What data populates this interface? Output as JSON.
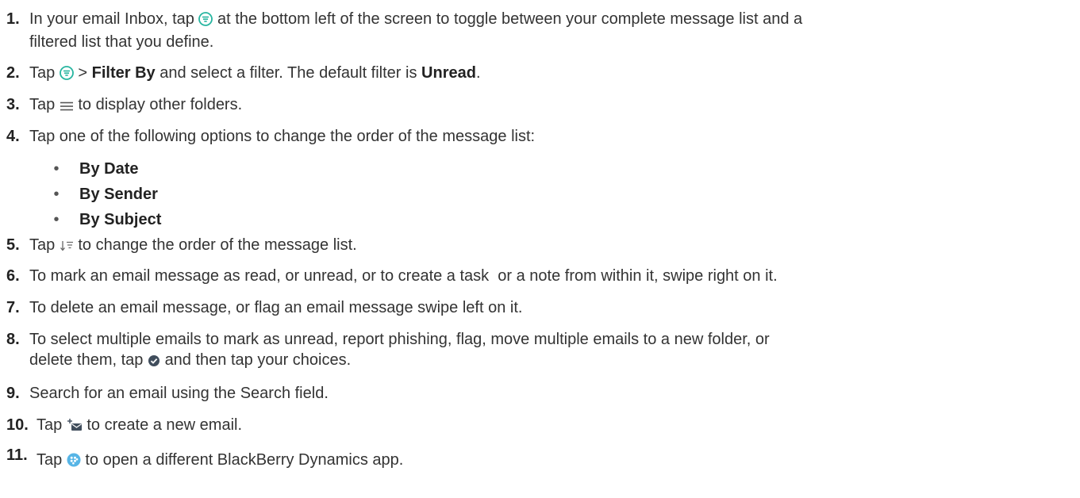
{
  "colors": {
    "text": "#333333",
    "heading": "#222222",
    "filter_icon": "#27b5a0",
    "checkmark_icon": "#404d5c",
    "dynamics_icon": "#57b5e6",
    "compose_icon": "#404d5c",
    "bullet": "#555555"
  },
  "steps": [
    {
      "number": "1.",
      "t1": "In your email Inbox, tap",
      "icon": "filter-icon",
      "t2": "at the bottom left of the screen to toggle between your complete message list and a",
      "line2": "filtered list that you define."
    },
    {
      "number": "2.",
      "t1": "Tap",
      "icon": "filter-icon",
      "t2": ">",
      "b1": "Filter By",
      "t3": "and select a filter. The default filter is",
      "b2": "Unread",
      "t4": "."
    },
    {
      "number": "3.",
      "t1": "Tap",
      "icon": "hamburger-menu-icon",
      "t2": "to display other folders."
    },
    {
      "number": "4.",
      "t1": "Tap one of the following options to change the order of the message list:",
      "options": [
        "By Date",
        "By Sender",
        "By Subject"
      ]
    },
    {
      "number": "5.",
      "t1": "Tap",
      "icon": "sort-order-icon",
      "t2": "to change the order of the message list."
    },
    {
      "number": "6.",
      "t1": "To mark an email message as read, or unread, or to create a task  or a note from within it, swipe right on it."
    },
    {
      "number": "7.",
      "t1": "To delete an email message, or flag an email message swipe left on it."
    },
    {
      "number": "8.",
      "t1": "To select multiple emails to mark as unread, report phishing, flag, move multiple emails to a new folder, or",
      "t2": "delete them, tap",
      "icon": "checkmark-circle-icon",
      "t3": "and then tap your choices."
    },
    {
      "number": "9.",
      "t1": "Search for an email using the Search field."
    },
    {
      "number": "10.",
      "t1": "Tap",
      "icon": "compose-email-icon",
      "t2": "to create a new email."
    },
    {
      "number": "11.",
      "t1": "Tap",
      "icon": "blackberry-dynamics-icon",
      "t2": "to open a different BlackBerry Dynamics app."
    }
  ],
  "bullet_char": "•"
}
